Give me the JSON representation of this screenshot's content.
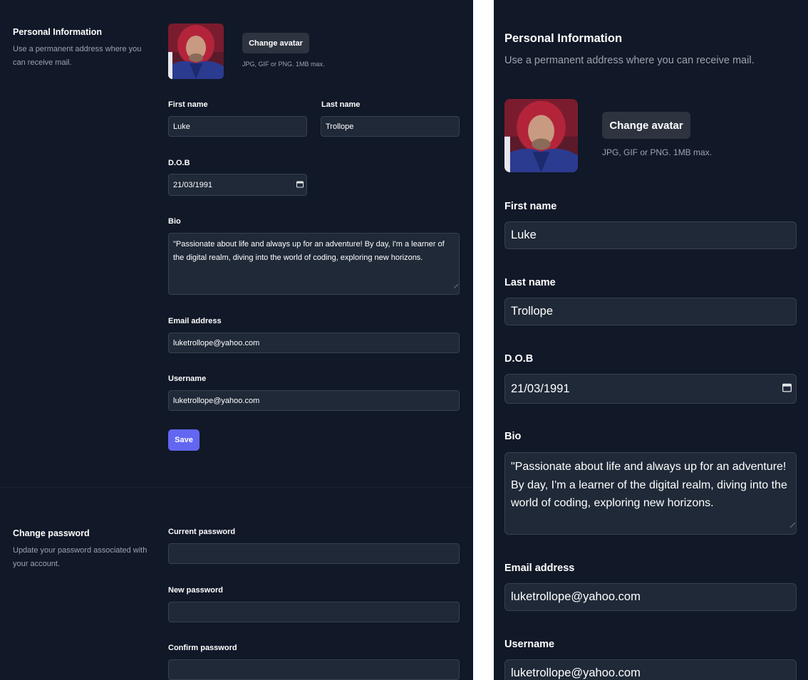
{
  "personal": {
    "title": "Personal Information",
    "desc_left": "Use a permanent address where you can receive mail.",
    "desc_right": "Use a permanent address where you can receive mail.",
    "change_avatar_label": "Change avatar",
    "avatar_hint": "JPG, GIF or PNG. 1MB max.",
    "first_name_label": "First name",
    "first_name_value": "Luke",
    "last_name_label": "Last name",
    "last_name_value": "Trollope",
    "dob_label": "D.O.B",
    "dob_value": "21/03/1991",
    "bio_label": "Bio",
    "bio_value": "\"Passionate about life and always up for an adventure! By day, I'm a learner of the digital realm, diving into the world of coding, exploring new horizons.",
    "email_label": "Email address",
    "email_value": "luketrollope@yahoo.com",
    "username_label": "Username",
    "username_value": "luketrollope@yahoo.com",
    "save_label": "Save"
  },
  "password": {
    "title": "Change password",
    "desc": "Update your password associated with your account.",
    "current_label": "Current password",
    "current_value": "",
    "new_label": "New password",
    "new_value": "",
    "confirm_label": "Confirm password",
    "confirm_value": ""
  },
  "icons": {
    "calendar": "calendar-icon",
    "avatar": "user-avatar-photo",
    "resize": "resize-handle-icon"
  },
  "colors": {
    "background": "#111827",
    "input_bg": "#1f2937",
    "input_border": "#374151",
    "muted_text": "#9ca3af",
    "primary": "#6366f1",
    "secondary_button": "#2d3440"
  }
}
